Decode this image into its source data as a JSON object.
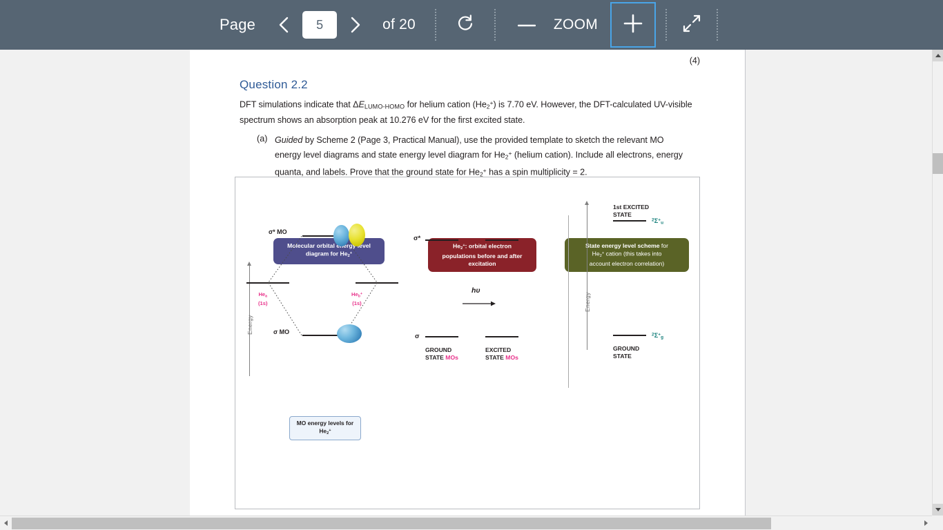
{
  "toolbar": {
    "page_label": "Page",
    "prev_icon": "chevron-left-icon",
    "page_value": "5",
    "next_icon": "chevron-right-icon",
    "of_total": "of 20",
    "rotate_icon": "rotate-icon",
    "zoom_out_label": "—",
    "zoom_label": "ZOOM",
    "zoom_in_label": "+",
    "fit_icon": "collapse-arrows-icon",
    "bar_color": "#566573",
    "focus_color": "#49a5e8"
  },
  "document": {
    "marks": "(4)",
    "question_title": "Question 2.2",
    "title_color": "#2e5a96",
    "paragraph_1_part1": "DFT simulations indicate that Δ",
    "paragraph_1_italic": "E",
    "paragraph_1_sub": "LUMO-HOMO",
    "paragraph_1_part2": " for helium cation (He",
    "paragraph_1_part3": ") is 7.70 eV. However, the DFT-calculated UV-visible spectrum shows an absorption peak at 10.276 eV for the first excited state.",
    "part_a_label": "(a)",
    "part_a_italic": "Guided",
    "part_a_text1": " by Scheme 2 (Page 3, Practical Manual), use the provided template to sketch the relevant MO energy level diagrams and state energy level diagram for He",
    "part_a_text2": " (helium cation). Include all electrons, energy quanta, and labels. Prove that the ground state for He",
    "part_a_text3": " has a spin multiplicity = 2."
  },
  "diagram": {
    "badges": {
      "mo": {
        "line1": "Molecular orbital energy level",
        "line2": "diagram for He",
        "color": "#4f4e8c"
      },
      "pop": {
        "line1a": "He",
        "line1b": ": orbital electron",
        "line2": "populations before and after",
        "line3": "excitation",
        "color": "#8a2229"
      },
      "state": {
        "line1_bold": "State energy level scheme",
        "line1_reg": " for",
        "line2a": "He",
        "line2b": " cation (this takes into",
        "line3": "account electron correlation)",
        "color": "#5a6326"
      }
    },
    "panel_mo": {
      "axis_label": "Energy",
      "sigma_star_label": "σ* MO",
      "sigma_label": "σ MO",
      "atom_left_l1": "He",
      "atom_left_l2": "(1s)",
      "atom_right_l1": "He",
      "atom_right_l2": "(1s)",
      "atom_label_color": "#e8318a",
      "caption_l1": "MO energy levels for",
      "caption_l2": "He",
      "orbital_blue": "#3d87bd",
      "orbital_yellow": "#cfc706"
    },
    "panel_pop": {
      "sigma_star_label": "σ*",
      "sigma_label": "σ",
      "photon_label": "hυ",
      "ground_l1": "GROUND",
      "ground_l2a": "STATE ",
      "ground_l2b": "MOs",
      "excited_l1": "EXCITED",
      "excited_l2a": "STATE ",
      "excited_l2b": "MOs",
      "mos_color": "#e8318a"
    },
    "panel_state": {
      "axis_label": "Energy",
      "excited_l1": "1st EXCITED",
      "excited_l2": "STATE",
      "ground_l1": "GROUND",
      "ground_l2": "STATE",
      "term_excited_pre": "2",
      "term_excited_sym": "Σ",
      "term_excited_sup": "+",
      "term_excited_sub": "u",
      "term_ground_pre": "2",
      "term_ground_sym": "Σ",
      "term_ground_sup": "+",
      "term_ground_sub": "g",
      "term_color": "#18807c"
    }
  },
  "scrollbars": {
    "v_up_icon": "triangle-up-icon",
    "v_down_icon": "triangle-down-icon",
    "h_left_icon": "triangle-left-icon",
    "h_right_icon": "triangle-right-icon"
  }
}
